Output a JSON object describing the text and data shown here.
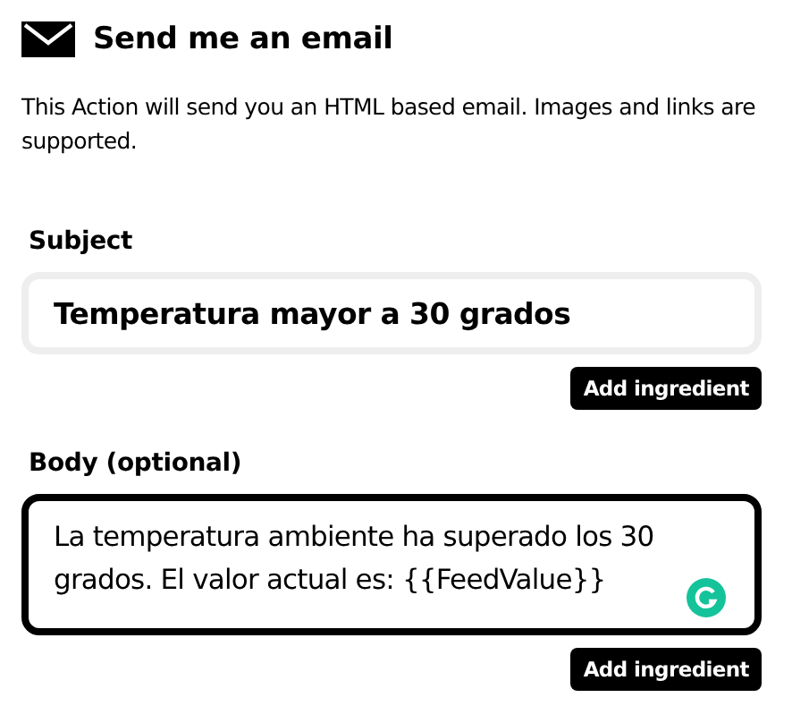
{
  "header": {
    "title": "Send me an email"
  },
  "description": "This Action will send you an HTML based email. Images and links are supported.",
  "fields": [
    {
      "label": "Subject",
      "kind": "input",
      "value": "Temperatura mayor a 30 grados",
      "focused": false,
      "button": "Add ingredient"
    },
    {
      "label": "Body (optional)",
      "kind": "textarea",
      "value": "La temperatura ambiente ha superado los 30 grados. El valor actual es: {{FeedValue}}",
      "focused": true,
      "button": "Add ingredient"
    }
  ]
}
